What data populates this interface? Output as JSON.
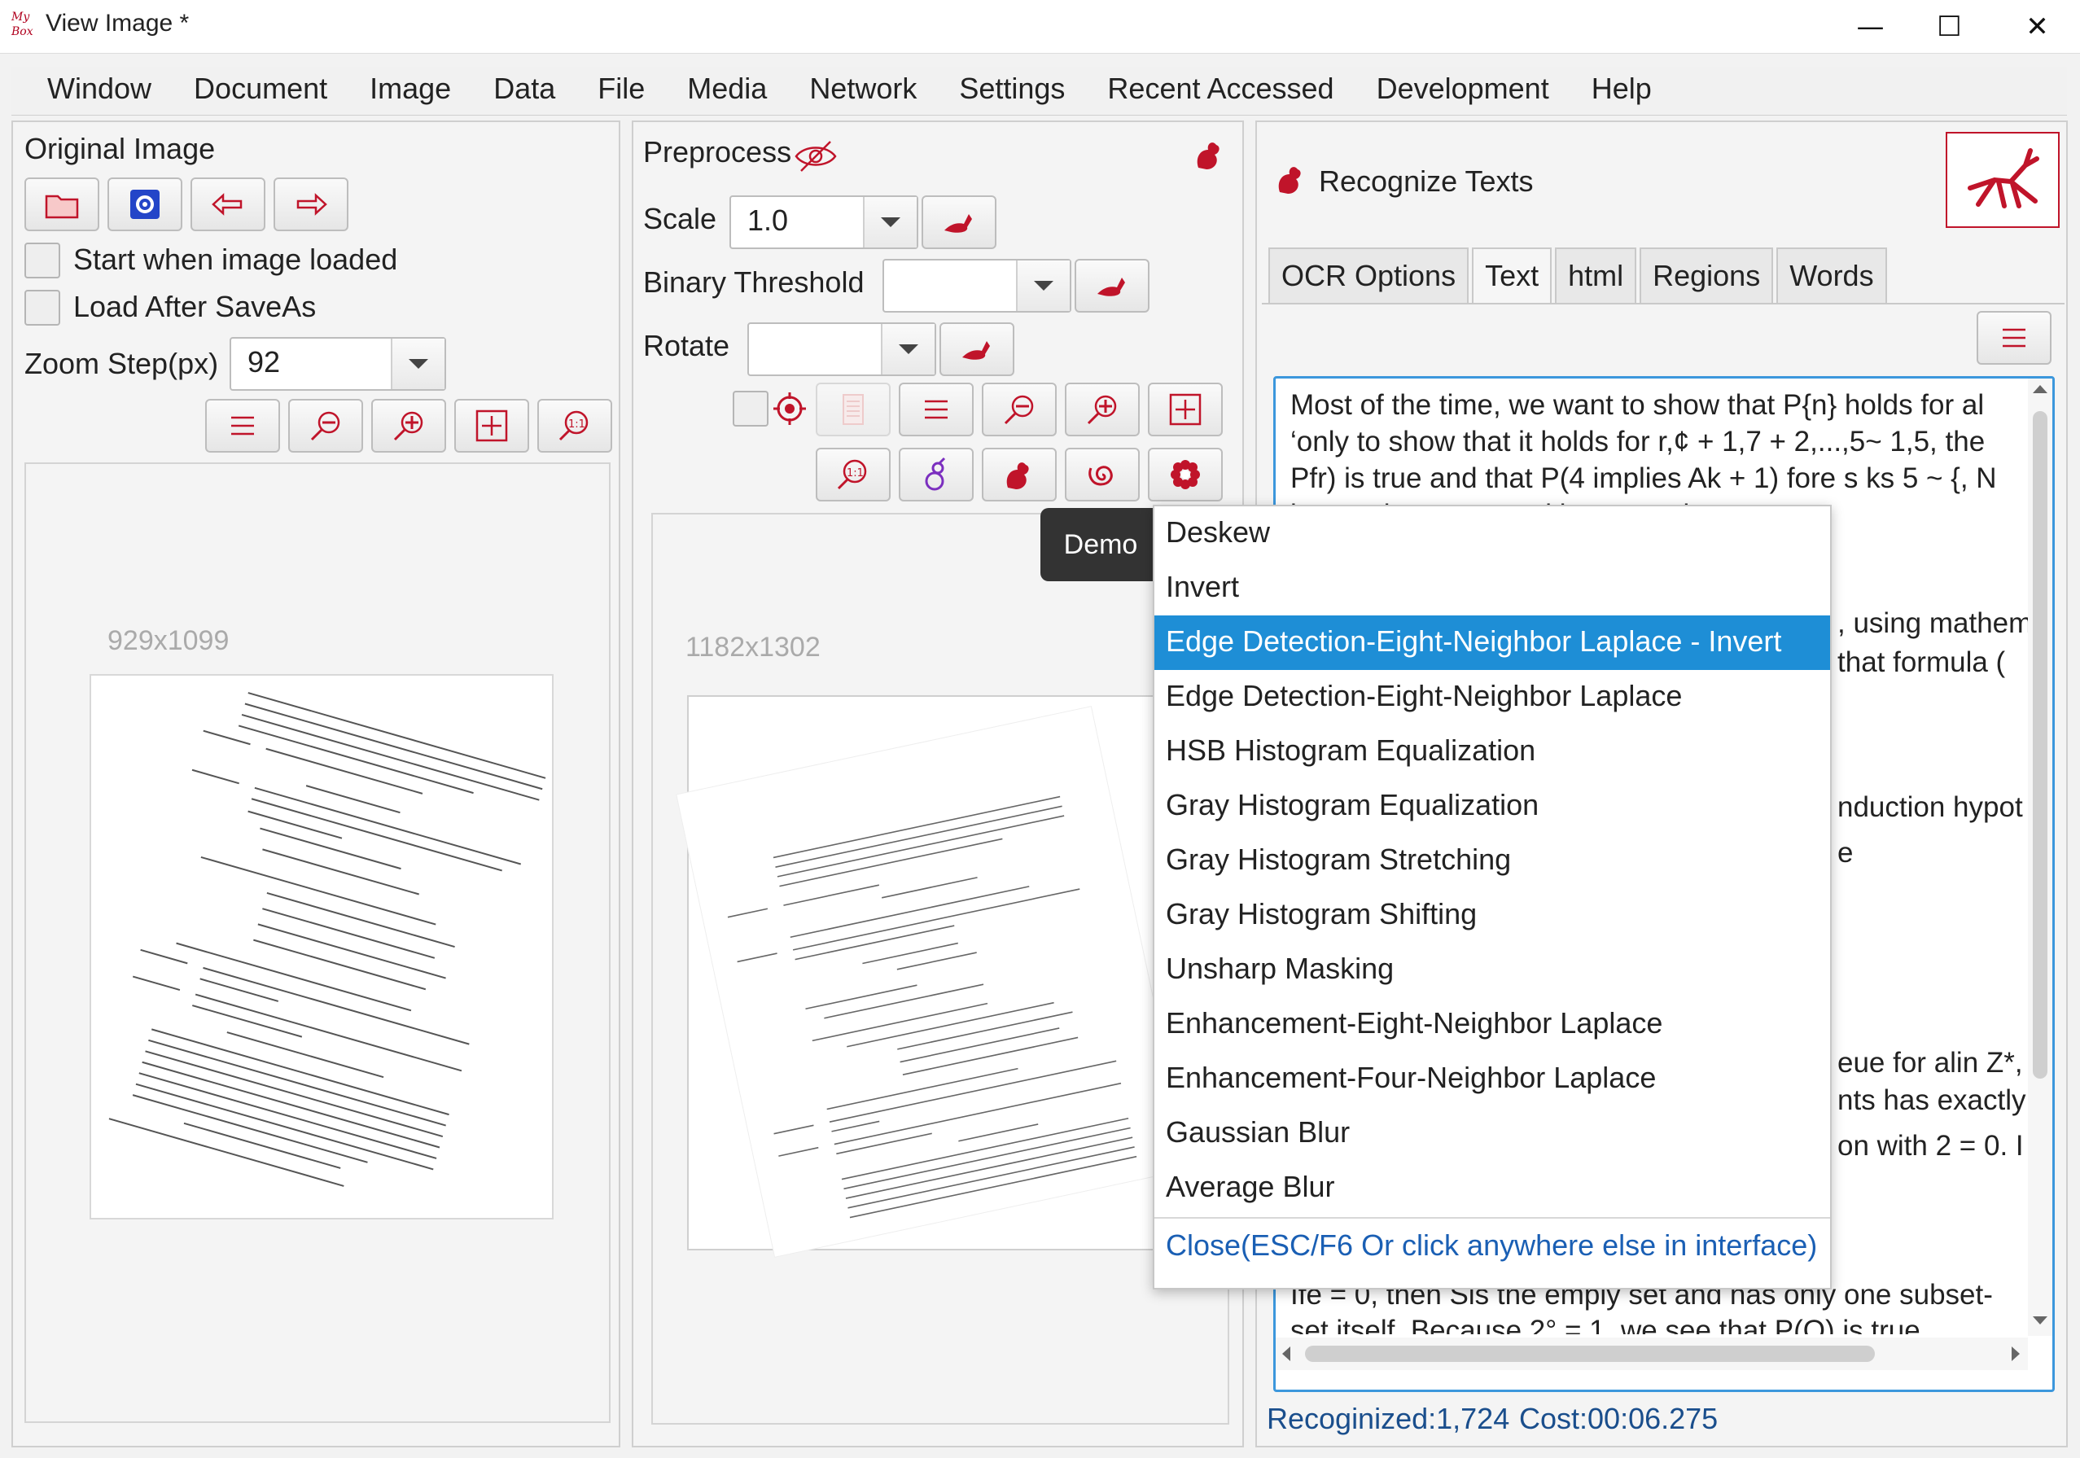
{
  "window": {
    "title": "View Image  *",
    "logo_text": "My Box",
    "minimize": "—",
    "maximize": "☐",
    "close": "✕"
  },
  "menu": [
    "Window",
    "Document",
    "Image",
    "Data",
    "File",
    "Media",
    "Network",
    "Settings",
    "Recent Accessed",
    "Development",
    "Help"
  ],
  "original": {
    "title": "Original Image",
    "start_when_loaded": "Start when image loaded",
    "load_after_saveas": "Load After SaveAs",
    "zoom_step_label": "Zoom Step(px)",
    "zoom_step_value": "92",
    "image_size": "929x1099"
  },
  "preprocess": {
    "title": "Preprocess",
    "scale_label": "Scale",
    "scale_value": "1.0",
    "binary_label": "Binary Threshold",
    "binary_value": "",
    "rotate_label": "Rotate",
    "rotate_value": "",
    "image_size": "1182x1302"
  },
  "recognize": {
    "title": "Recognize Texts",
    "tabs": [
      "OCR Options",
      "Text",
      "html",
      "Regions",
      "Words"
    ],
    "active_tab": "Text",
    "text_lines": [
      "Most of the time, we want to show that P{n} holds for al",
      "‘only to show that it holds for r,¢ + 1,7 + 2,...,5~ 1,5, the",
      "Pfr) is true and that P(4 implies Ak + 1) fore s ks 5 ~ {, N",
      "be any integer—positive, negative, or zero."
    ],
    "right_fragments": [
      ", using mathem",
      " that formula (",
      "nduction hypot",
      "e",
      "eue for alin Z*,",
      "nts has exactly",
      "on with 2 = 0. I"
    ],
    "bottom_line": "Ife = 0, then Sis the empiy set and has only one subset-",
    "bottom_partial": "set itself. Because 2° = 1, we see that P(O) is true",
    "status_recognized": "Recoginized:1,724",
    "status_cost": "Cost:00:06.275"
  },
  "demo_tooltip": "Demo",
  "popup": {
    "items": [
      "Deskew",
      "Invert",
      "Edge Detection-Eight-Neighbor Laplace - Invert",
      "Edge Detection-Eight-Neighbor Laplace",
      "HSB Histogram Equalization",
      "Gray Histogram Equalization",
      "Gray Histogram Stretching",
      "Gray Histogram Shifting",
      "Unsharp Masking",
      "Enhancement-Eight-Neighbor Laplace",
      "Enhancement-Four-Neighbor Laplace",
      "Gaussian Blur",
      "Average Blur"
    ],
    "selected": "Edge Detection-Eight-Neighbor Laplace - Invert",
    "close_text": "Close(ESC/F6 Or click anywhere else in interface)"
  },
  "colors": {
    "accent_red": "#c0142a",
    "selection_blue": "#1e8ed6",
    "status_blue": "#1a4e8c"
  },
  "icons": {
    "toolbar_original": [
      "folder-icon",
      "settings-icon",
      "arrow-left-icon",
      "arrow-right-icon"
    ],
    "zoom_original": [
      "pane-size-icon",
      "zoom-out-icon",
      "zoom-in-icon",
      "fit-window-icon",
      "actual-size-icon"
    ],
    "preprocess_row1": [
      "target-icon",
      "document-icon",
      "pane-size-icon",
      "zoom-out-icon",
      "zoom-in-icon",
      "fit-window-icon"
    ],
    "preprocess_row2": [
      "actual-size-icon",
      "gourd-icon",
      "rooster-icon",
      "spiral-icon",
      "flower-icon"
    ]
  }
}
